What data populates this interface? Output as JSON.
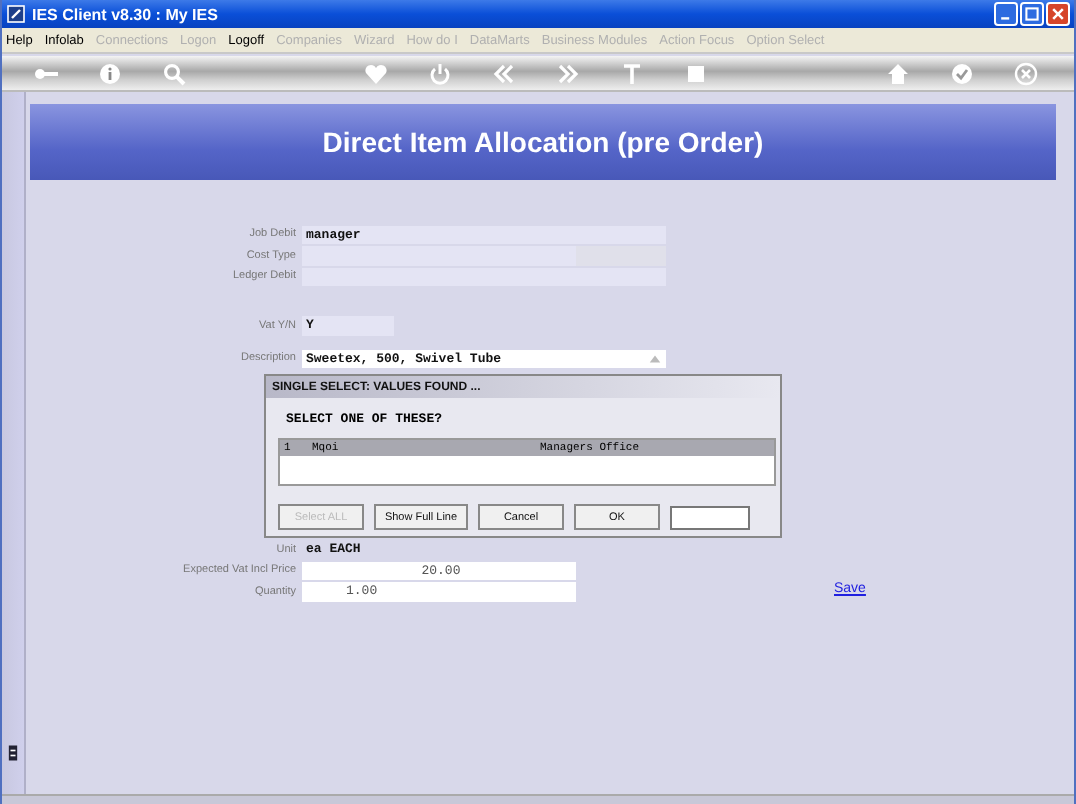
{
  "window": {
    "title": "IES Client v8.30 : My IES"
  },
  "menu": [
    {
      "label": "Help",
      "disabled": false
    },
    {
      "label": "Infolab",
      "disabled": false
    },
    {
      "label": "Connections",
      "disabled": true
    },
    {
      "label": "Logon",
      "disabled": true
    },
    {
      "label": "Logoff",
      "disabled": false
    },
    {
      "label": "Companies",
      "disabled": true
    },
    {
      "label": "Wizard",
      "disabled": true
    },
    {
      "label": "How do I",
      "disabled": true
    },
    {
      "label": "DataMarts",
      "disabled": true
    },
    {
      "label": "Business Modules",
      "disabled": true
    },
    {
      "label": "Action Focus",
      "disabled": true
    },
    {
      "label": "Option Select",
      "disabled": true
    }
  ],
  "page_title": "Direct Item Allocation (pre Order)",
  "fields": [
    {
      "label": "Job Debit",
      "value": "manager",
      "kind": "wide"
    },
    {
      "label": "Cost Type",
      "kind": "split"
    },
    {
      "label": "Ledger Debit",
      "kind": "wide"
    },
    {
      "label": "Vat Y/N",
      "value": "Y",
      "kind": "short"
    },
    {
      "label": "Description",
      "value": "Sweetex, 500, Swivel Tube",
      "kind": "memo"
    }
  ],
  "lower_fields": [
    {
      "label": "Unit",
      "value": "ea EACH",
      "kind": "flat"
    },
    {
      "label": "Expected Vat Incl Price",
      "value": "20.00",
      "kind": "center"
    },
    {
      "label": "Quantity",
      "value": "1.00",
      "kind": "left"
    }
  ],
  "save_link": "Save",
  "dialog": {
    "title": "SINGLE SELECT: VALUES FOUND ...",
    "prompt": "SELECT ONE OF THESE?",
    "rows": [
      {
        "number": "1",
        "code": "Mqoi",
        "name": "Managers Office",
        "selected": true
      }
    ],
    "buttons": [
      {
        "label": "Select ALL",
        "disabled": true
      },
      {
        "label": "Show Full Line",
        "disabled": false
      },
      {
        "label": "Cancel",
        "disabled": false
      },
      {
        "label": "OK",
        "disabled": false
      }
    ]
  }
}
